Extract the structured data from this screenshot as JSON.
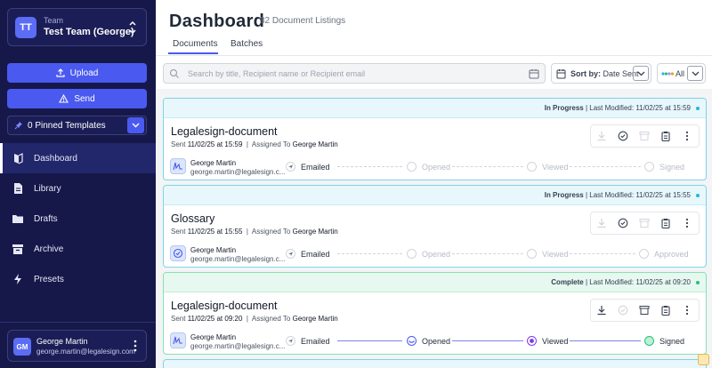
{
  "sidebar": {
    "team_label": "Team",
    "team_name": "Test Team (George)",
    "team_initials": "TT",
    "upload_label": "Upload",
    "send_label": "Send",
    "pinned_label": "0 Pinned Templates",
    "nav": [
      {
        "label": "Dashboard",
        "icon": "dashboard-icon",
        "active": true
      },
      {
        "label": "Library",
        "icon": "library-icon"
      },
      {
        "label": "Drafts",
        "icon": "drafts-icon"
      },
      {
        "label": "Archive",
        "icon": "archive-icon"
      },
      {
        "label": "Presets",
        "icon": "presets-icon"
      }
    ],
    "user": {
      "initials": "GM",
      "name": "George Martin",
      "email": "george.martin@legalesign.com"
    }
  },
  "header": {
    "title": "Dashboard",
    "subtitle": "82 Document Listings",
    "tabs": [
      {
        "label": "Documents",
        "active": true
      },
      {
        "label": "Batches"
      }
    ]
  },
  "toolbar": {
    "search_placeholder": "Search by title, Recipient name or Recipient email",
    "sort_label": "Sort by:",
    "sort_value": "Date Sent",
    "filter_label": "All"
  },
  "documents": [
    {
      "status": "In Progress",
      "last_modified_label": "Last Modified:",
      "last_modified": "11/02/25 at 15:59",
      "name": "Legalesign-document",
      "sent_label": "Sent",
      "sent_at": "11/02/25 at 15:59",
      "assigned_label": "Assigned To",
      "assigned_to": "George Martin",
      "recipient_name": "George Martin",
      "recipient_email": "george.martin@legalesign.c...",
      "steps": [
        {
          "label": "Emailed",
          "done": true
        },
        {
          "label": "Opened",
          "done": false
        },
        {
          "label": "Viewed",
          "done": false
        },
        {
          "label": "Signed",
          "done": false
        }
      ]
    },
    {
      "status": "In Progress",
      "last_modified_label": "Last Modified:",
      "last_modified": "11/02/25 at 15:55",
      "name": "Glossary",
      "sent_label": "Sent",
      "sent_at": "11/02/25 at 15:55",
      "assigned_label": "Assigned To",
      "assigned_to": "George Martin",
      "recipient_name": "George Martin",
      "recipient_email": "george.martin@legalesign.c...",
      "steps": [
        {
          "label": "Emailed",
          "done": true
        },
        {
          "label": "Opened",
          "done": false
        },
        {
          "label": "Viewed",
          "done": false
        },
        {
          "label": "Approved",
          "done": false
        }
      ]
    },
    {
      "status": "Complete",
      "last_modified_label": "Last Modified:",
      "last_modified": "11/02/25 at 09:20",
      "name": "Legalesign-document",
      "sent_label": "Sent",
      "sent_at": "11/02/25 at 09:20",
      "assigned_label": "Assigned To",
      "assigned_to": "George Martin",
      "recipient_name": "George Martin",
      "recipient_email": "george.martin@legalesign.c...",
      "steps": [
        {
          "label": "Emailed",
          "done": true
        },
        {
          "label": "Opened",
          "done": true
        },
        {
          "label": "Viewed",
          "done": true
        },
        {
          "label": "Signed",
          "done": true
        }
      ]
    }
  ],
  "colors": {
    "sidebar_bg": "#16184a",
    "accent": "#4a5af0",
    "in_progress": "#22b8d9",
    "complete": "#22c27a"
  }
}
